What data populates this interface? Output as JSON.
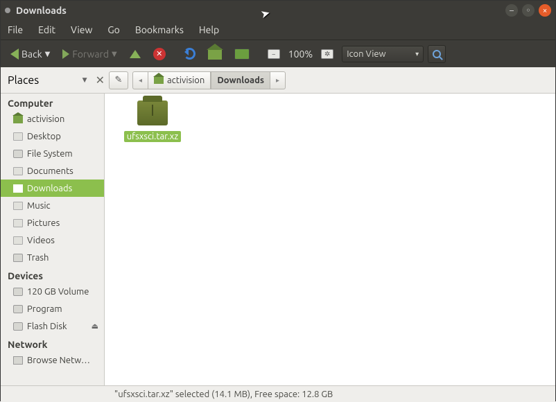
{
  "window": {
    "title": "Downloads"
  },
  "menu": {
    "file": "File",
    "edit": "Edit",
    "view": "View",
    "go": "Go",
    "bookmarks": "Bookmarks",
    "help": "Help"
  },
  "toolbar": {
    "back": "Back",
    "forward": "Forward",
    "zoom": "100%",
    "view_mode": "Icon View"
  },
  "breadcrumb": {
    "seg1": "activision",
    "seg2": "Downloads"
  },
  "sidebar": {
    "header": "Places",
    "computer": "Computer",
    "devices": "Devices",
    "network": "Network",
    "items": {
      "home": "activision",
      "desktop": "Desktop",
      "filesystem": "File System",
      "documents": "Documents",
      "downloads": "Downloads",
      "music": "Music",
      "pictures": "Pictures",
      "videos": "Videos",
      "trash": "Trash",
      "vol": "120 GB Volume",
      "program": "Program",
      "flash": "Flash Disk",
      "browse": "Browse Netw…"
    }
  },
  "files": {
    "f1": "ufsxsci.tar.xz"
  },
  "status": "\"ufsxsci.tar.xz\" selected (14.1 MB), Free space: 12.8 GB"
}
